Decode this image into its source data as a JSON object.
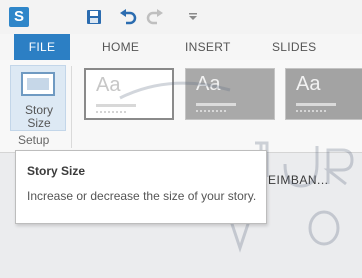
{
  "quick_access": {
    "app_icon": "storyline-app-icon",
    "save_icon": "save-icon",
    "undo_icon": "undo-icon",
    "redo_icon": "redo-icon",
    "customize_icon": "customize-dropdown-icon"
  },
  "ribbon": {
    "tabs": [
      {
        "label": "FILE"
      },
      {
        "label": "HOME"
      },
      {
        "label": "INSERT"
      },
      {
        "label": "SLIDES"
      }
    ],
    "setup_group": {
      "button_label_line1": "Story",
      "button_label_line2": "Size",
      "group_label": "Setup"
    },
    "themes": [
      {
        "label": "Aa"
      },
      {
        "label": "Aa"
      },
      {
        "label": "Aa"
      }
    ]
  },
  "document": {
    "title_fragment": "EIMBAN..."
  },
  "tooltip": {
    "title": "Story Size",
    "description": "Increase or decrease the size of your story."
  },
  "colors": {
    "accent": "#2c7fc4",
    "tab_text": "#555555"
  }
}
